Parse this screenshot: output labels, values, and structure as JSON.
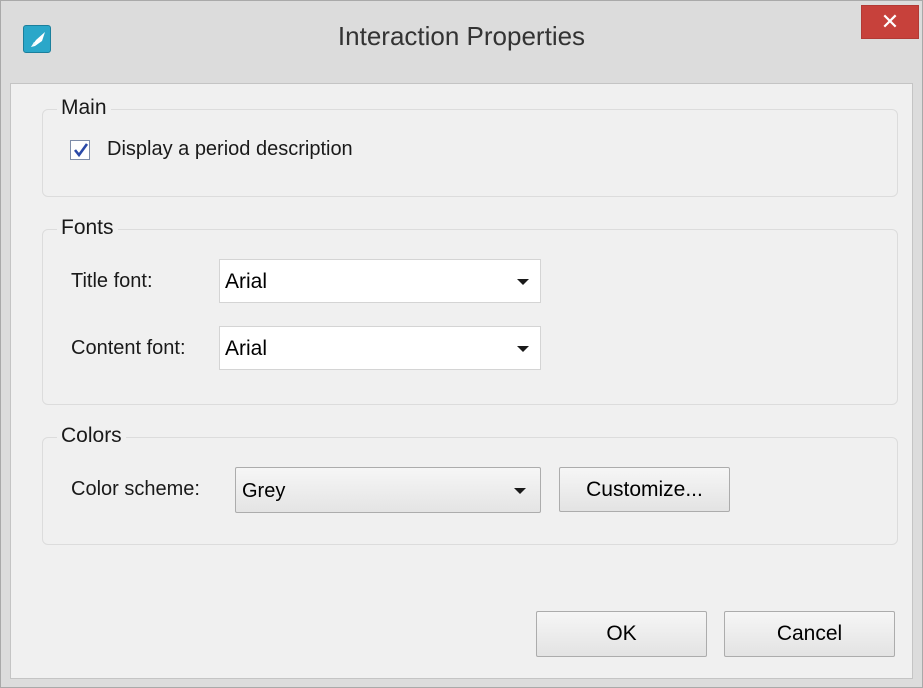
{
  "window": {
    "title": "Interaction Properties",
    "close_label": "✕"
  },
  "main_group": {
    "label": "Main",
    "display_period_description": {
      "label": "Display a period description",
      "checked": true
    }
  },
  "fonts_group": {
    "label": "Fonts",
    "title_font": {
      "label": "Title font:",
      "value": "Arial"
    },
    "content_font": {
      "label": "Content font:",
      "value": "Arial"
    }
  },
  "colors_group": {
    "label": "Colors",
    "color_scheme": {
      "label": "Color scheme:",
      "value": "Grey"
    },
    "customize_label": "Customize..."
  },
  "footer": {
    "ok_label": "OK",
    "cancel_label": "Cancel"
  },
  "colors": {
    "close_button": "#c7413b",
    "app_icon": "#2aa7c9",
    "dialog_background": "#f0f0f0"
  }
}
